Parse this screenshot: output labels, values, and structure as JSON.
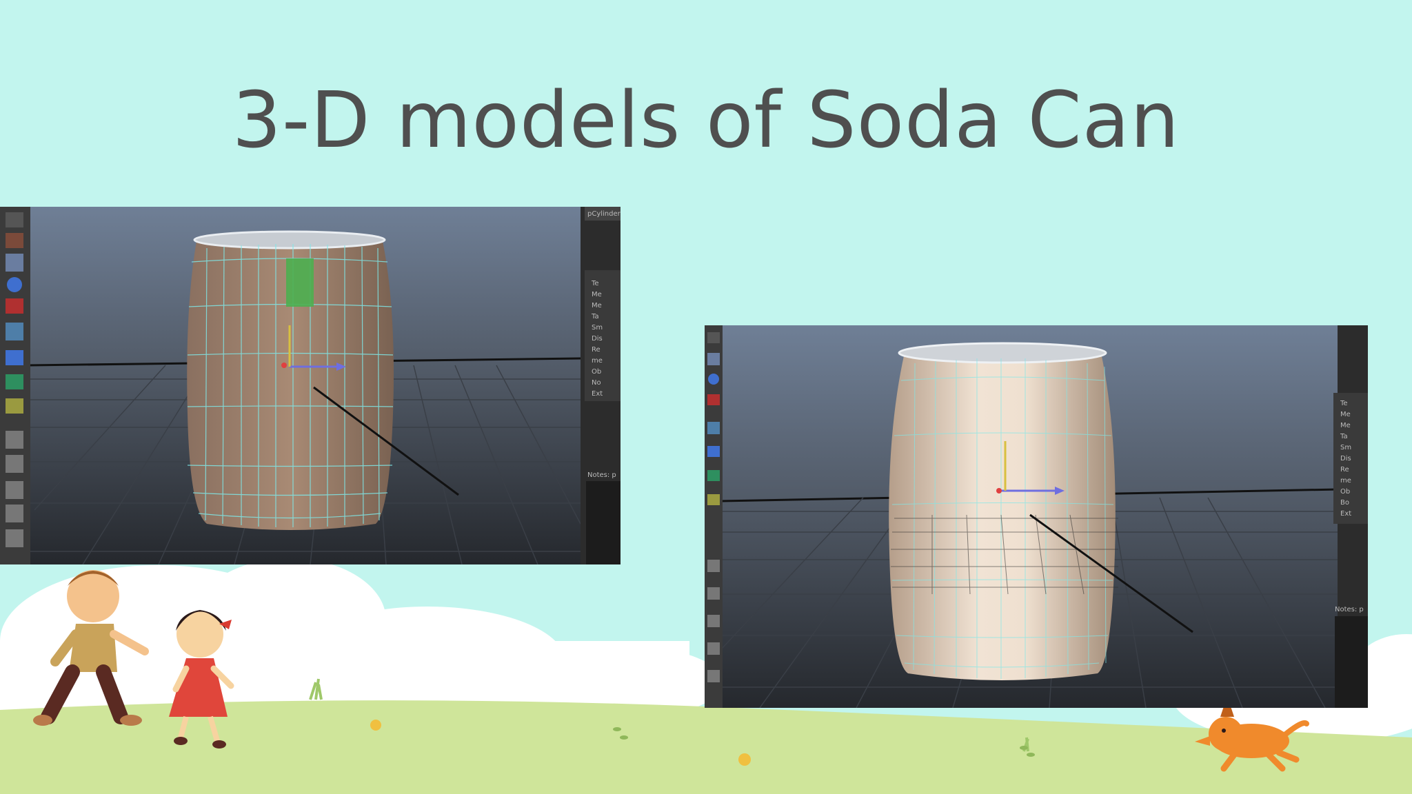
{
  "slide": {
    "title": "3-D models of Soda Can"
  },
  "colors": {
    "background": "#c2f5ee",
    "title_text": "#4f4f4f",
    "grass": "#cfe59a",
    "cloud": "#ffffff",
    "can_body_left": "#a88a74",
    "can_body_right": "#e6d5c3",
    "wireframe": "#7fe8e8",
    "selected_face": "#4caf50"
  },
  "left_screenshot": {
    "attribute_header": "pCylinder",
    "attribute_items": [
      "Te",
      "Me",
      "Me",
      "Ta",
      "Sm",
      "Dis",
      "Re",
      "me",
      "Ob",
      "No",
      "Ext"
    ],
    "notes_label": "Notes: p"
  },
  "right_screenshot": {
    "attribute_items": [
      "Te",
      "Me",
      "Me",
      "Ta",
      "Sm",
      "Dis",
      "Re",
      "me",
      "Ob",
      "Bo",
      "Ext"
    ],
    "notes_label": "Notes: p"
  },
  "illustrations": {
    "characters": [
      "boy-running",
      "girl-running",
      "dog-running"
    ]
  }
}
